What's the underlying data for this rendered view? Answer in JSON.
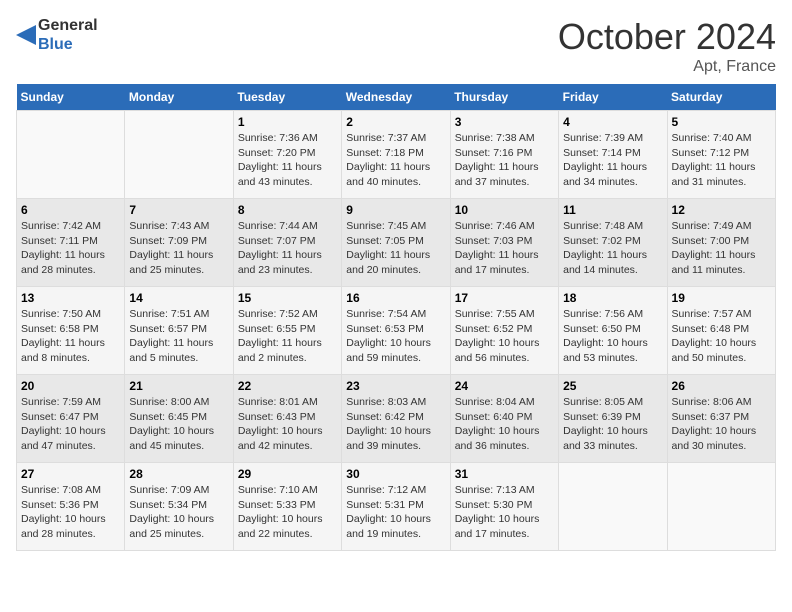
{
  "header": {
    "logo_line1": "General",
    "logo_line2": "Blue",
    "month": "October 2024",
    "location": "Apt, France"
  },
  "days_of_week": [
    "Sunday",
    "Monday",
    "Tuesday",
    "Wednesday",
    "Thursday",
    "Friday",
    "Saturday"
  ],
  "weeks": [
    [
      {
        "day": "",
        "sunrise": "",
        "sunset": "",
        "daylight": ""
      },
      {
        "day": "",
        "sunrise": "",
        "sunset": "",
        "daylight": ""
      },
      {
        "day": "1",
        "sunrise": "Sunrise: 7:36 AM",
        "sunset": "Sunset: 7:20 PM",
        "daylight": "Daylight: 11 hours and 43 minutes."
      },
      {
        "day": "2",
        "sunrise": "Sunrise: 7:37 AM",
        "sunset": "Sunset: 7:18 PM",
        "daylight": "Daylight: 11 hours and 40 minutes."
      },
      {
        "day": "3",
        "sunrise": "Sunrise: 7:38 AM",
        "sunset": "Sunset: 7:16 PM",
        "daylight": "Daylight: 11 hours and 37 minutes."
      },
      {
        "day": "4",
        "sunrise": "Sunrise: 7:39 AM",
        "sunset": "Sunset: 7:14 PM",
        "daylight": "Daylight: 11 hours and 34 minutes."
      },
      {
        "day": "5",
        "sunrise": "Sunrise: 7:40 AM",
        "sunset": "Sunset: 7:12 PM",
        "daylight": "Daylight: 11 hours and 31 minutes."
      }
    ],
    [
      {
        "day": "6",
        "sunrise": "Sunrise: 7:42 AM",
        "sunset": "Sunset: 7:11 PM",
        "daylight": "Daylight: 11 hours and 28 minutes."
      },
      {
        "day": "7",
        "sunrise": "Sunrise: 7:43 AM",
        "sunset": "Sunset: 7:09 PM",
        "daylight": "Daylight: 11 hours and 25 minutes."
      },
      {
        "day": "8",
        "sunrise": "Sunrise: 7:44 AM",
        "sunset": "Sunset: 7:07 PM",
        "daylight": "Daylight: 11 hours and 23 minutes."
      },
      {
        "day": "9",
        "sunrise": "Sunrise: 7:45 AM",
        "sunset": "Sunset: 7:05 PM",
        "daylight": "Daylight: 11 hours and 20 minutes."
      },
      {
        "day": "10",
        "sunrise": "Sunrise: 7:46 AM",
        "sunset": "Sunset: 7:03 PM",
        "daylight": "Daylight: 11 hours and 17 minutes."
      },
      {
        "day": "11",
        "sunrise": "Sunrise: 7:48 AM",
        "sunset": "Sunset: 7:02 PM",
        "daylight": "Daylight: 11 hours and 14 minutes."
      },
      {
        "day": "12",
        "sunrise": "Sunrise: 7:49 AM",
        "sunset": "Sunset: 7:00 PM",
        "daylight": "Daylight: 11 hours and 11 minutes."
      }
    ],
    [
      {
        "day": "13",
        "sunrise": "Sunrise: 7:50 AM",
        "sunset": "Sunset: 6:58 PM",
        "daylight": "Daylight: 11 hours and 8 minutes."
      },
      {
        "day": "14",
        "sunrise": "Sunrise: 7:51 AM",
        "sunset": "Sunset: 6:57 PM",
        "daylight": "Daylight: 11 hours and 5 minutes."
      },
      {
        "day": "15",
        "sunrise": "Sunrise: 7:52 AM",
        "sunset": "Sunset: 6:55 PM",
        "daylight": "Daylight: 11 hours and 2 minutes."
      },
      {
        "day": "16",
        "sunrise": "Sunrise: 7:54 AM",
        "sunset": "Sunset: 6:53 PM",
        "daylight": "Daylight: 10 hours and 59 minutes."
      },
      {
        "day": "17",
        "sunrise": "Sunrise: 7:55 AM",
        "sunset": "Sunset: 6:52 PM",
        "daylight": "Daylight: 10 hours and 56 minutes."
      },
      {
        "day": "18",
        "sunrise": "Sunrise: 7:56 AM",
        "sunset": "Sunset: 6:50 PM",
        "daylight": "Daylight: 10 hours and 53 minutes."
      },
      {
        "day": "19",
        "sunrise": "Sunrise: 7:57 AM",
        "sunset": "Sunset: 6:48 PM",
        "daylight": "Daylight: 10 hours and 50 minutes."
      }
    ],
    [
      {
        "day": "20",
        "sunrise": "Sunrise: 7:59 AM",
        "sunset": "Sunset: 6:47 PM",
        "daylight": "Daylight: 10 hours and 47 minutes."
      },
      {
        "day": "21",
        "sunrise": "Sunrise: 8:00 AM",
        "sunset": "Sunset: 6:45 PM",
        "daylight": "Daylight: 10 hours and 45 minutes."
      },
      {
        "day": "22",
        "sunrise": "Sunrise: 8:01 AM",
        "sunset": "Sunset: 6:43 PM",
        "daylight": "Daylight: 10 hours and 42 minutes."
      },
      {
        "day": "23",
        "sunrise": "Sunrise: 8:03 AM",
        "sunset": "Sunset: 6:42 PM",
        "daylight": "Daylight: 10 hours and 39 minutes."
      },
      {
        "day": "24",
        "sunrise": "Sunrise: 8:04 AM",
        "sunset": "Sunset: 6:40 PM",
        "daylight": "Daylight: 10 hours and 36 minutes."
      },
      {
        "day": "25",
        "sunrise": "Sunrise: 8:05 AM",
        "sunset": "Sunset: 6:39 PM",
        "daylight": "Daylight: 10 hours and 33 minutes."
      },
      {
        "day": "26",
        "sunrise": "Sunrise: 8:06 AM",
        "sunset": "Sunset: 6:37 PM",
        "daylight": "Daylight: 10 hours and 30 minutes."
      }
    ],
    [
      {
        "day": "27",
        "sunrise": "Sunrise: 7:08 AM",
        "sunset": "Sunset: 5:36 PM",
        "daylight": "Daylight: 10 hours and 28 minutes."
      },
      {
        "day": "28",
        "sunrise": "Sunrise: 7:09 AM",
        "sunset": "Sunset: 5:34 PM",
        "daylight": "Daylight: 10 hours and 25 minutes."
      },
      {
        "day": "29",
        "sunrise": "Sunrise: 7:10 AM",
        "sunset": "Sunset: 5:33 PM",
        "daylight": "Daylight: 10 hours and 22 minutes."
      },
      {
        "day": "30",
        "sunrise": "Sunrise: 7:12 AM",
        "sunset": "Sunset: 5:31 PM",
        "daylight": "Daylight: 10 hours and 19 minutes."
      },
      {
        "day": "31",
        "sunrise": "Sunrise: 7:13 AM",
        "sunset": "Sunset: 5:30 PM",
        "daylight": "Daylight: 10 hours and 17 minutes."
      },
      {
        "day": "",
        "sunrise": "",
        "sunset": "",
        "daylight": ""
      },
      {
        "day": "",
        "sunrise": "",
        "sunset": "",
        "daylight": ""
      }
    ]
  ]
}
